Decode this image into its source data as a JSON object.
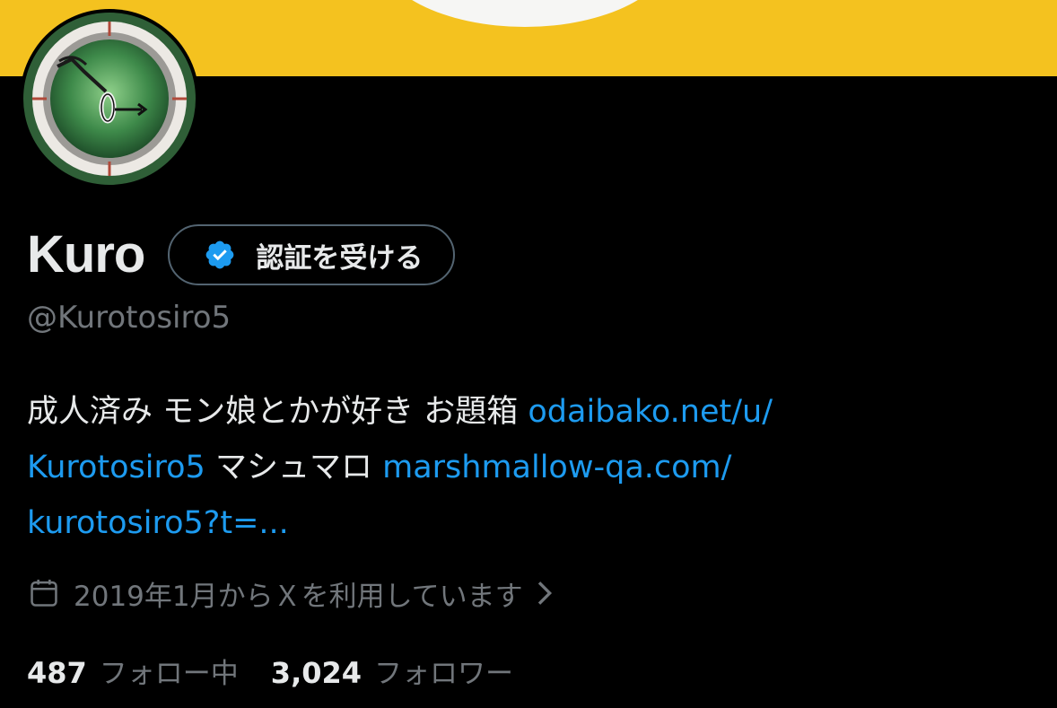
{
  "profile": {
    "display_name": "Kuro",
    "verify_button_label": "認証を受ける",
    "handle": "@Kurotosiro5",
    "bio": {
      "text_1": "成人済み モン娘とかが好き お題箱 ",
      "link_1_a": "odaibako.net/u/",
      "link_1_b": "Kurotosiro5",
      "text_2": " マシュマロ ",
      "link_2_a": "marshmallow-qa.com/",
      "link_2_b": "kurotosiro5?t=..."
    },
    "joined": "2019年1月からＸを利用しています",
    "following_count": "487",
    "following_label": "フォロー中",
    "followers_count": "3,024",
    "followers_label": "フォロワー"
  },
  "icons": {
    "avatar": "clock-dial-avatar",
    "badge": "verified-badge-icon",
    "calendar": "calendar-icon",
    "chevron": "chevron-right-icon"
  },
  "colors": {
    "background": "#000000",
    "banner": "#f4c21f",
    "link": "#1d9bf0",
    "secondary_text": "#71767b",
    "primary_text": "#e7e9ea"
  }
}
